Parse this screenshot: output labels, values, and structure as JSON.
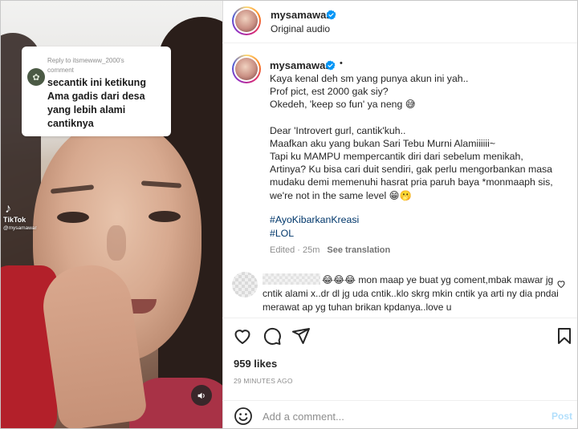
{
  "reply": {
    "header_line1": "Reply to itsmewww_2000's",
    "header_line2": "comment",
    "text": "secantik ini ketikung Ama gadis dari desa yang lebih alami cantiknya"
  },
  "tiktok": {
    "logo_label": "TikTok",
    "handle": "@mysamawar"
  },
  "post": {
    "username": "mysamawar",
    "audio": "Original audio",
    "caption_username": "mysamawar",
    "caption_dot": "•",
    "caption_p1": "Kaya kenal deh sm yang punya akun ini yah..\nProf pict, est 2000 gak siy?\nOkedeh, 'keep so fun' ya neng 😅",
    "caption_p2": "Dear 'Introvert gurl, cantik'kuh..\nMaafkan aku yang bukan Sari Tebu Murni Alamiiiiii~\nTapi ku MAMPU mempercantik diri dari sebelum menikah,\nArtinya? Ku bisa cari duit sendiri, gak perlu mengorbankan masa\nmudaku demi memenuhi hasrat pria paruh baya *monmaaph sis,\nwe're not in the same level 😁🫢",
    "hashtag1": "#AyoKibarkanKreasi",
    "hashtag2": "#LOL",
    "edited": "Edited · 25m",
    "see_translation": "See translation",
    "likes": "959 likes",
    "time": "29 MINUTES AGO"
  },
  "comment": {
    "text": "😂😂😂 mon maap ye buat yg coment,mbak mawar jg cntik alami x..dr dl jg uda cntik..klo skrg mkin cntik ya arti ny dia pndai merawat ap yg tuhan brikan kpdanya..love u"
  },
  "add_comment": {
    "placeholder": "Add a comment...",
    "post_label": "Post"
  },
  "colors": {
    "verified": "#0095f6",
    "hashtag": "#00376b",
    "post_disabled": "#b2dffc",
    "secondary_text": "#8e8e8e"
  }
}
